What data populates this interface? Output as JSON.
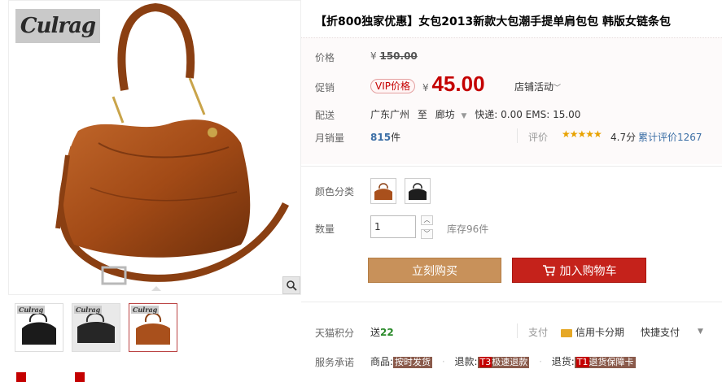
{
  "brand": {
    "logo_text": "Culrag"
  },
  "product": {
    "title": "【折800独家优惠】女包2013新款大包潮手提单肩包包 韩版女链条包"
  },
  "price": {
    "label": "价格",
    "currency": "¥",
    "original": "150.00"
  },
  "promo": {
    "label": "促销",
    "badge": "VIP价格",
    "currency": "¥",
    "price": "45.00",
    "shop_activity": "店铺活动"
  },
  "shipping": {
    "label": "配送",
    "from": "广东广州",
    "to_word": "至",
    "destination": "廊坊",
    "fees": "快递: 0.00  EMS: 15.00"
  },
  "sales": {
    "label": "月销量",
    "value": "815",
    "unit": "件",
    "rating_label": "评价",
    "stars": "★★★★★",
    "rating_value": 4.7,
    "rating_text": "4.7分",
    "review_link": "累计评价1267"
  },
  "options": {
    "color_label": "颜色分类",
    "qty_label": "数量",
    "qty_value": "1",
    "stock": "库存96件"
  },
  "actions": {
    "buy_now": "立刻购买",
    "add_cart": "加入购物车"
  },
  "extras": {
    "points_label": "天猫积分",
    "points_prefix": "送",
    "points_value": "22",
    "pay_label": "支付",
    "pay_credit": "信用卡分期",
    "pay_quick": "快捷支付",
    "service_label": "服务承诺",
    "svc_goods": "商品:",
    "svc_goods_tag": "按时发货",
    "svc_refund": "退款:",
    "svc_refund_tag_t": "T3",
    "svc_refund_tag": "极速退款",
    "svc_return": "退货:",
    "svc_return_tag_t": "T1",
    "svc_return_tag": "退货保障卡"
  },
  "colors": {
    "accent": "#c40000",
    "buy_button": "#c8915a",
    "cart_button": "#c5221b",
    "link": "#3b6ea5"
  },
  "icons": [
    "zoom-icon",
    "cart-icon",
    "dropdown-arrow-icon",
    "credit-card-icon",
    "star-icon"
  ]
}
